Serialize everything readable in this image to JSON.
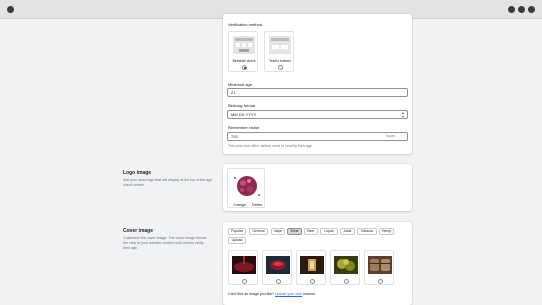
{
  "verification": {
    "method_label": "Verification method",
    "options": [
      {
        "label": "Birthdate check",
        "selected": true,
        "icon": "birthdate-form-icon"
      },
      {
        "label": "Yes/no buttons",
        "selected": false,
        "icon": "yes-no-buttons-icon"
      }
    ],
    "minimum_age_label": "Minimum age",
    "minimum_age_value": "21",
    "birthday_format_label": "Birthday format",
    "birthday_format_value": "MM DD YYYY",
    "remember_label": "Remember visitor",
    "remember_value": "720",
    "remember_suffix": "hours",
    "remember_help": "This sets how often visitors need to reverify their age."
  },
  "logo": {
    "title": "Logo image",
    "description": "Add your store logo that will display at the top of the age check screen.",
    "change_label": "Change",
    "delete_label": "Delete"
  },
  "cover": {
    "title": "Cover image",
    "description": "Customize the cover image. The cover image blocks the view of your website content until visitors verify their age.",
    "tabs": [
      "Popular",
      "General",
      "Vape",
      "Wine",
      "Beer",
      "Liquor",
      "Adult",
      "Tobacco",
      "Hemp",
      "Upload"
    ],
    "active_tab": "Wine",
    "images": [
      {
        "name": "wine-pour-image",
        "color": "#5a1a1f"
      },
      {
        "name": "wine-glass-image",
        "color": "#7a1820"
      },
      {
        "name": "cellar-image",
        "color": "#6b4a2e"
      },
      {
        "name": "vineyard-image",
        "color": "#6a6a1e"
      },
      {
        "name": "barrels-image",
        "color": "#8a6a4a"
      }
    ],
    "footer_prefix": "Can't find an image you like? ",
    "footer_link": "Upload your own",
    "footer_suffix": " instead."
  },
  "colors": {
    "accent_link": "#2c6ecb",
    "card_bg": "#ffffff",
    "page_bg": "#f1f2f3"
  }
}
